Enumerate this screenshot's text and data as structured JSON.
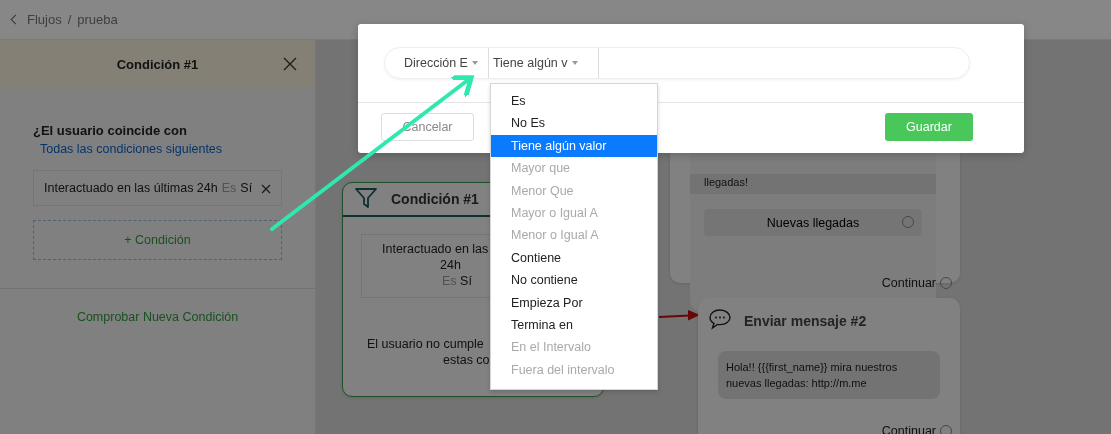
{
  "breadcrumb": {
    "back": "Flujos",
    "separator": "/",
    "current": "prueba"
  },
  "side_panel": {
    "title": "Condición #1",
    "match_label": "¿El usuario coincide con",
    "match_mode": "Todas las condiciones siguientes",
    "conditions": [
      {
        "field": "Interactuado en las últimas 24h",
        "operator": "Es",
        "value": "Sí"
      }
    ],
    "add_button": "+ Condición",
    "check_button": "Comprobar Nueva Condición"
  },
  "canvas": {
    "nodes": [
      {
        "kind": "condition",
        "title": "Condición #1",
        "lines": [
          "Interactuado en las",
          "24h"
        ],
        "operator": "Es",
        "value": "Sí",
        "footer_lines": [
          "El usuario no cumple",
          "estas co"
        ]
      },
      {
        "kind": "message",
        "message": "llegadas!",
        "buttons": [
          "Nuevas llegadas"
        ],
        "continue": "Continuar"
      },
      {
        "kind": "message",
        "title": "Enviar mensaje #2",
        "message": "Hola!! {{{first_name}} mira nuestros nuevas llegadas: http://m.me",
        "continue": "Continuar"
      }
    ]
  },
  "modal": {
    "filters": [
      {
        "label": "Dirección E"
      },
      {
        "label": "Tiene algún v"
      }
    ],
    "cancel": "Cancelar",
    "save": "Guardar"
  },
  "dropdown": {
    "items": [
      {
        "label": "Es",
        "selected": false,
        "disabled": false
      },
      {
        "label": "No Es",
        "selected": false,
        "disabled": false
      },
      {
        "label": "Tiene algún valor",
        "selected": true,
        "disabled": false
      },
      {
        "label": "Mayor que",
        "selected": false,
        "disabled": true
      },
      {
        "label": "Menor Que",
        "selected": false,
        "disabled": true
      },
      {
        "label": "Mayor o Igual A",
        "selected": false,
        "disabled": true
      },
      {
        "label": "Menor o Igual A",
        "selected": false,
        "disabled": true
      },
      {
        "label": "Contiene",
        "selected": false,
        "disabled": false
      },
      {
        "label": "No contiene",
        "selected": false,
        "disabled": false
      },
      {
        "label": "Empieza Por",
        "selected": false,
        "disabled": false
      },
      {
        "label": "Termina en",
        "selected": false,
        "disabled": false
      },
      {
        "label": "En el Intervalo",
        "selected": false,
        "disabled": true
      },
      {
        "label": "Fuera del intervalo",
        "selected": false,
        "disabled": true
      }
    ]
  }
}
